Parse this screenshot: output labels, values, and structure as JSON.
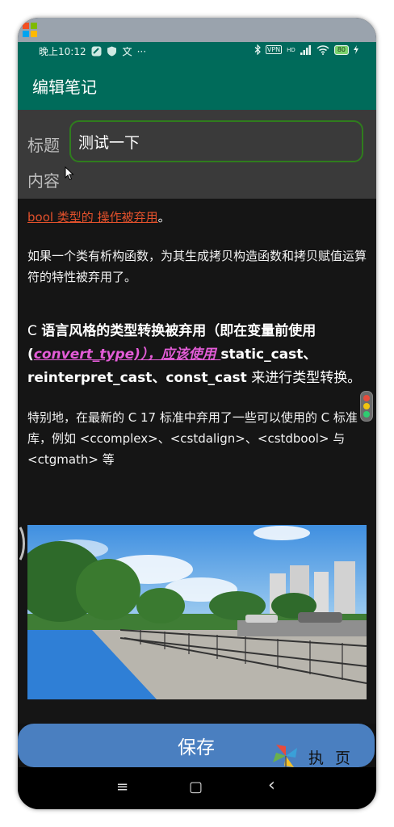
{
  "status_bar": {
    "time": "晚上10:12",
    "more": "···",
    "vpn": "VPN",
    "signal": "HD",
    "battery": "80"
  },
  "toolbar": {
    "title": "编辑笔记"
  },
  "form": {
    "title_label": "标题",
    "title_value": "测试一下",
    "content_label": "内容"
  },
  "content": {
    "p1_link": "bool 类型的 操作被弃用",
    "p1_end": "。",
    "p2": "如果一个类有析构函数，为其生成拷贝构造函数和拷贝赋值运算符的特性被弃用了。",
    "p3_a": "C ",
    "p3_b": "语言风格的类型转换被弃用（即在变量前使用 (",
    "p3_c": "convert_type)），应该使用 ",
    "p3_d": "static_cast、reinterpret_cast、const_cast",
    "p3_e": " 来进行类型转换。",
    "p4": "特别地，在最新的 C 17 标准中弃用了一些可以使用的 C 标准库，例如 <ccomplex>、<cstdalign>、<cstdbool> 与 <ctgmath> 等"
  },
  "save_button": {
    "label": "保存"
  },
  "watermark": {
    "text": "执 页"
  },
  "icons": {
    "nav_menu": "≡",
    "nav_home": "▢",
    "nav_back": "‹"
  },
  "colors": {
    "toolbar": "#006b5a",
    "status_bar": "#00695c",
    "save_button": "#4a7fc0",
    "link_red": "#e3512c",
    "link_pink": "#e35cd7",
    "input_border": "#2f7d1d"
  }
}
